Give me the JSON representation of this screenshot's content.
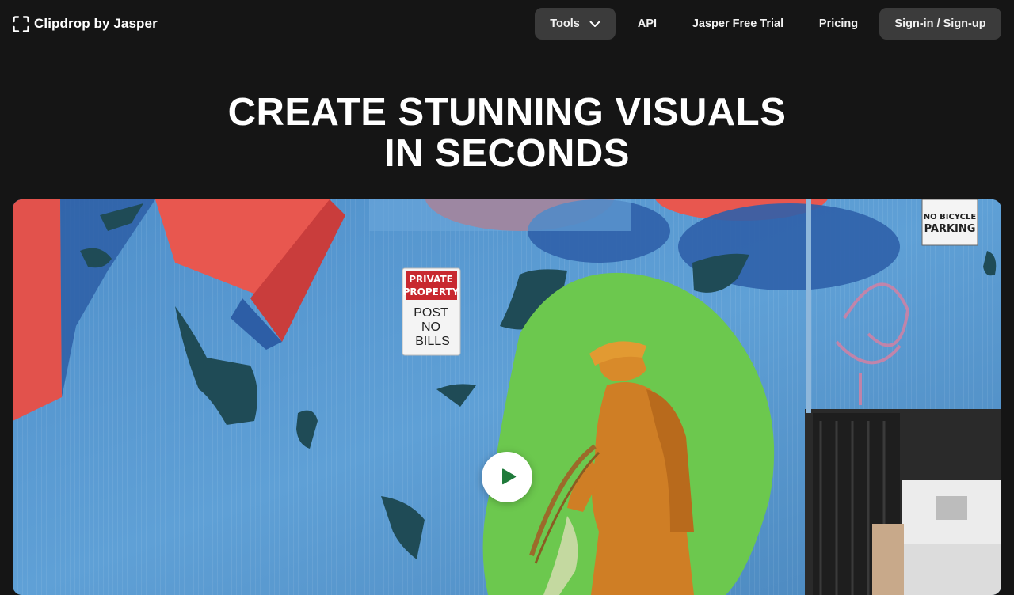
{
  "brand": {
    "name": "Clipdrop by Jasper",
    "icon": "clipdrop-logo-icon"
  },
  "nav": {
    "tools": "Tools",
    "api": "API",
    "trial": "Jasper Free Trial",
    "pricing": "Pricing",
    "signin": "Sign-in / Sign-up"
  },
  "hero": {
    "line1": "CREATE STUNNING VISUALS",
    "line2": "IN SECONDS"
  },
  "video": {
    "signs": {
      "private1": "PRIVATE",
      "private2": "PROPERTY",
      "post1": "POST",
      "post2": "NO",
      "post3": "BILLS",
      "bicycle1": "NO BICYCLE",
      "bicycle2": "PARKING"
    },
    "play_icon": "play-icon"
  },
  "colors": {
    "background": "#151515",
    "nav_button": "#3b3b3b",
    "mural_blue": "#5b9ad0",
    "mural_red": "#e8574f",
    "segmentation_green": "#6cc84e",
    "worker_orange": "#d88a2a"
  }
}
